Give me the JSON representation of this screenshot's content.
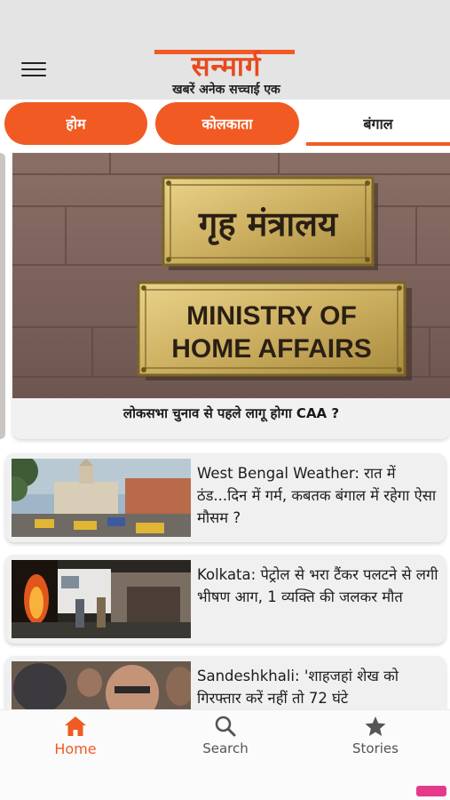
{
  "header": {
    "logo_title": "सन्मार्ग",
    "logo_tagline": "खबरें अनेक सच्चाई एक"
  },
  "tabs": [
    {
      "label": "होम"
    },
    {
      "label": "कोलकाता"
    },
    {
      "label": "बंगाल"
    }
  ],
  "featured": {
    "sign_hindi": "गृह मंत्रालय",
    "sign_english_1": "MINISTRY OF",
    "sign_english_2": "HOME AFFAIRS",
    "title": "लोकसभा चुनाव से पहले लागू होगा CAA ?"
  },
  "news": [
    {
      "text": "West Bengal Weather: रात में ठंड...दिन में गर्म, कबतक बंगाल में रहेगा ऐसा मौसम ?"
    },
    {
      "text": "Kolkata: पेट्रोल से भरा टैंकर पलटने से लगी भीषण आग, 1 व्यक्ति की जलकर मौत"
    },
    {
      "text": "Sandeshkhali: 'शाहजहां शेख को गिरफ्तार करें नहीं तो 72 घंटे"
    }
  ],
  "bottom_nav": [
    {
      "label": "Home",
      "icon": "home-icon",
      "active": true
    },
    {
      "label": "Search",
      "icon": "search-icon",
      "active": false
    },
    {
      "label": "Stories",
      "icon": "star-icon",
      "active": false
    }
  ],
  "colors": {
    "accent": "#f15a22",
    "header_bg": "#e4e4e4"
  }
}
